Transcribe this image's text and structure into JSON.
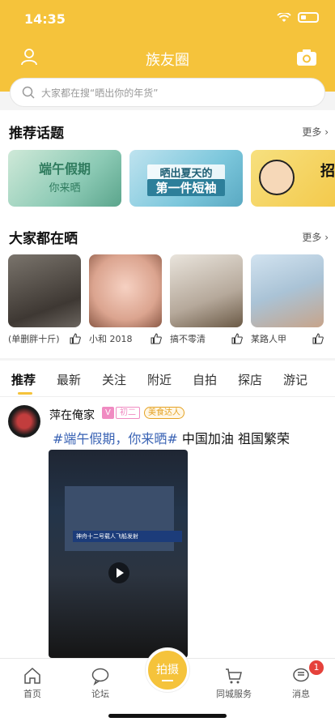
{
  "status": {
    "time": "14:35"
  },
  "header": {
    "title": "族友圈"
  },
  "search": {
    "placeholder": "大家都在搜“晒出你的年货”"
  },
  "topics_section": {
    "title": "推荐话题",
    "more": "更多 ›",
    "cards": [
      {
        "title": "端午假期",
        "subtitle": "你来晒"
      },
      {
        "title": "晒出夏天的",
        "subtitle": "第一件短袖"
      },
      {
        "title": "招"
      }
    ]
  },
  "posts_section": {
    "title": "大家都在晒",
    "more": "更多 ›",
    "items": [
      {
        "name": "(单删胖十斤)"
      },
      {
        "name": "小和 2018"
      },
      {
        "name": "搞不零清"
      },
      {
        "name": "某路人甲"
      }
    ]
  },
  "tabs": [
    "推荐",
    "最新",
    "关注",
    "附近",
    "自拍",
    "探店",
    "游记"
  ],
  "feed": {
    "author": "萍在俺家",
    "badge_v": "V",
    "badge_level": "初二",
    "badge_food": "美食达人",
    "tag": "#端午假期，你来晒#",
    "text": " 中国加油 祖国繁荣",
    "video_caption": "神舟十二号载人飞船发射"
  },
  "nav": {
    "home": "首页",
    "forum": "论坛",
    "shoot": "拍摄",
    "service": "同城服务",
    "messages": "消息",
    "badge": "1"
  },
  "colors": {
    "accent": "#f5c33b",
    "tag": "#3a63b4",
    "notify": "#e5413b"
  }
}
